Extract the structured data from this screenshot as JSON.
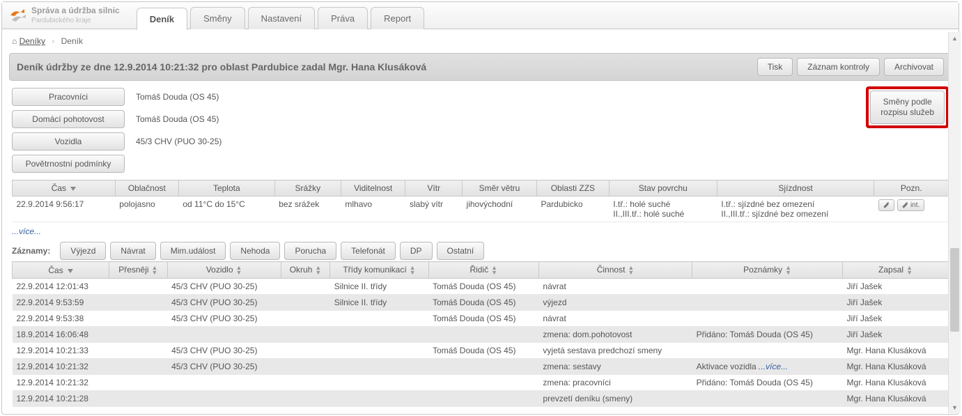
{
  "logo": {
    "line1": "Správa a údržba silnic",
    "line2": "Pardubického kraje"
  },
  "tabs": [
    "Deník",
    "Směny",
    "Nastavení",
    "Práva",
    "Report"
  ],
  "active_tab": 0,
  "breadcrumbs": {
    "home": "Deníky",
    "current": "Deník"
  },
  "title": "Deník údržby ze dne 12.9.2014 10:21:32 pro oblast Pardubice zadal Mgr. Hana Klusáková",
  "title_buttons": {
    "print": "Tisk",
    "inspection": "Záznam kontroly",
    "archive": "Archivovat"
  },
  "side_button": "Směny podle rozpisu služeb",
  "details": {
    "workers": {
      "label": "Pracovníci",
      "value": "Tomáš Douda (OS 45)"
    },
    "home_standby": {
      "label": "Domácí pohotovost",
      "value": "Tomáš Douda (OS 45)"
    },
    "vehicles": {
      "label": "Vozidla",
      "value": "45/3 CHV (PUO 30-25)"
    },
    "weather": {
      "label": "Povětrnostní podmínky"
    }
  },
  "weather_table": {
    "headers": [
      "Čas",
      "Oblačnost",
      "Teplota",
      "Srážky",
      "Viditelnost",
      "Vítr",
      "Směr větru",
      "Oblasti ZZS",
      "Stav povrchu",
      "Sjízdnost",
      "Pozn."
    ],
    "row": {
      "time": "22.9.2014 9:56:17",
      "clouds": "polojasno",
      "temp": "od 11°C do 15°C",
      "precip": "bez srážek",
      "visibility": "mlhavo",
      "wind": "slabý vítr",
      "wind_dir": "jihovýchodní",
      "zzs": "Pardubicko",
      "surface_a": "I.tř.: holé suché",
      "surface_b": "II.,III.tř.: holé suché",
      "pass_a": "I.tř.: sjízdné bez omezení",
      "pass_b": "II.,III.tř.: sjízdné bez omezení",
      "int_label": "int."
    },
    "more": "...více..."
  },
  "records": {
    "label": "Záznamy:",
    "buttons": [
      "Výjezd",
      "Návrat",
      "Mim.událost",
      "Nehoda",
      "Porucha",
      "Telefonát",
      "DP",
      "Ostatní"
    ],
    "headers": [
      "Čas",
      "Přesněji",
      "Vozidlo",
      "Okruh",
      "Třídy komunikací",
      "Řidič",
      "Činnost",
      "Poznámky",
      "Zapsal"
    ],
    "rows": [
      {
        "time": "22.9.2014 12:01:43",
        "pres": "",
        "veh": "45/3 CHV (PUO 30-25)",
        "okr": "",
        "trida": "Silnice II. třídy",
        "ridic": "Tomáš Douda (OS 45)",
        "cin": "návrat",
        "pozn": "",
        "zapsal": "Jiří Jašek"
      },
      {
        "time": "22.9.2014 9:53:59",
        "pres": "",
        "veh": "45/3 CHV (PUO 30-25)",
        "okr": "",
        "trida": "Silnice II. třídy",
        "ridic": "Tomáš Douda (OS 45)",
        "cin": "výjezd",
        "pozn": "",
        "zapsal": "Jiří Jašek",
        "zebra": true
      },
      {
        "time": "22.9.2014 9:53:38",
        "pres": "",
        "veh": "45/3 CHV (PUO 30-25)",
        "okr": "",
        "trida": "",
        "ridic": "Tomáš Douda (OS 45)",
        "cin": "návrat",
        "pozn": "",
        "zapsal": "Jiří Jašek"
      },
      {
        "time": "18.9.2014 16:06:48",
        "pres": "",
        "veh": "",
        "okr": "",
        "trida": "",
        "ridic": "",
        "cin": "zmena: dom.pohotovost",
        "pozn": "Přidáno: Tomáš Douda (OS 45)",
        "zapsal": "Jiří Jašek",
        "zebra": true
      },
      {
        "time": "12.9.2014 10:21:33",
        "pres": "",
        "veh": "45/3 CHV (PUO 30-25)",
        "okr": "",
        "trida": "",
        "ridic": "Tomáš Douda (OS 45)",
        "cin": "vyjetá sestava predchozí smeny",
        "pozn": "",
        "zapsal": "Mgr. Hana Klusáková"
      },
      {
        "time": "12.9.2014 10:21:32",
        "pres": "",
        "veh": "45/3 CHV (PUO 30-25)",
        "okr": "",
        "trida": "",
        "ridic": "",
        "cin": "zmena: sestavy",
        "pozn": "Aktivace vozidla ",
        "pozn_more": "...více...",
        "zapsal": "Mgr. Hana Klusáková",
        "zebra": true
      },
      {
        "time": "12.9.2014 10:21:32",
        "pres": "",
        "veh": "",
        "okr": "",
        "trida": "",
        "ridic": "",
        "cin": "zmena: pracovníci",
        "pozn": "Přidáno: Tomáš Douda (OS 45)",
        "zapsal": "Mgr. Hana Klusáková"
      },
      {
        "time": "12.9.2014 10:21:28",
        "pres": "",
        "veh": "",
        "okr": "",
        "trida": "",
        "ridic": "",
        "cin": "prevzetí deníku (smeny)",
        "pozn": "",
        "zapsal": "Mgr. Hana Klusáková",
        "zebra": true
      }
    ]
  }
}
